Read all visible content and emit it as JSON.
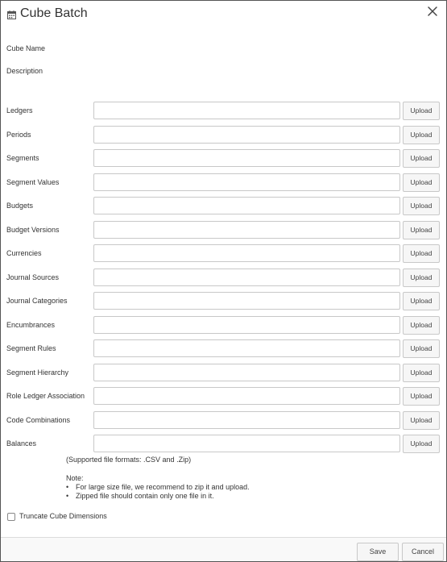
{
  "dialog": {
    "title": "Cube Batch",
    "title_icon": "calendar-icon",
    "close_icon": "close-icon"
  },
  "fields": {
    "cube_name_label": "Cube Name",
    "description_label": "Description"
  },
  "rows": [
    {
      "label": "Ledgers",
      "value": "",
      "button": "Upload"
    },
    {
      "label": "Periods",
      "value": "",
      "button": "Upload"
    },
    {
      "label": "Segments",
      "value": "",
      "button": "Upload"
    },
    {
      "label": "Segment Values",
      "value": "",
      "button": "Upload"
    },
    {
      "label": "Budgets",
      "value": "",
      "button": "Upload"
    },
    {
      "label": "Budget Versions",
      "value": "",
      "button": "Upload"
    },
    {
      "label": "Currencies",
      "value": "",
      "button": "Upload"
    },
    {
      "label": "Journal Sources",
      "value": "",
      "button": "Upload"
    },
    {
      "label": "Journal Categories",
      "value": "",
      "button": "Upload"
    },
    {
      "label": "Encumbrances",
      "value": "",
      "button": "Upload"
    },
    {
      "label": "Segment Rules",
      "value": "",
      "button": "Upload"
    },
    {
      "label": "Segment Hierarchy",
      "value": "",
      "button": "Upload"
    },
    {
      "label": "Role Ledger Association",
      "value": "",
      "button": "Upload"
    },
    {
      "label": "Code Combinations",
      "value": "",
      "button": "Upload"
    },
    {
      "label": "Balances",
      "value": "",
      "button": "Upload"
    }
  ],
  "supported_formats": "(Supported file formats: .CSV and .Zip)",
  "note": {
    "title": "Note:",
    "items": [
      "For large size file, we recommend to zip it and upload.",
      "Zipped file should contain only one file in it."
    ]
  },
  "truncate": {
    "label": "Truncate Cube Dimensions",
    "checked": false
  },
  "footer": {
    "save_label": "Save",
    "cancel_label": "Cancel"
  }
}
